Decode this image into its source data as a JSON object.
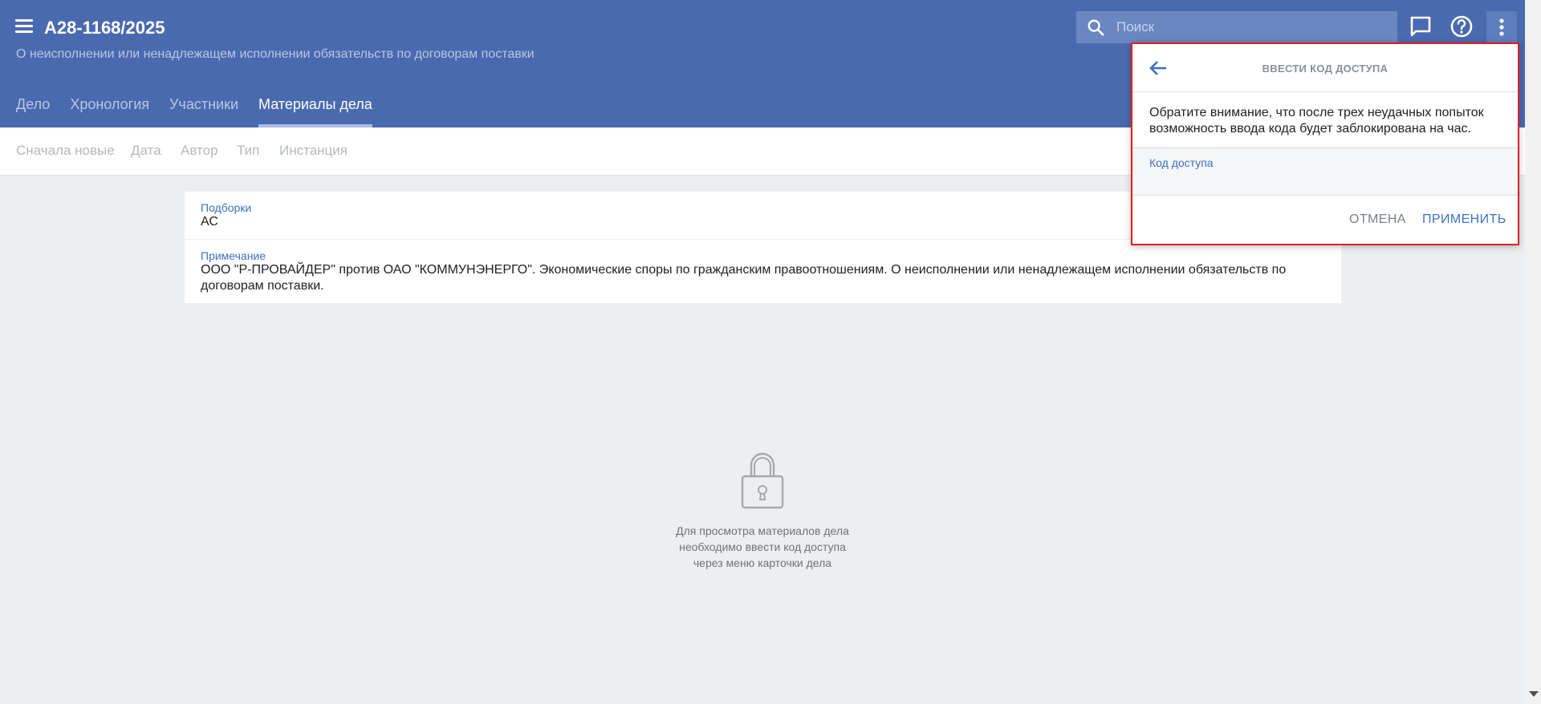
{
  "header": {
    "case_number": "А28-1168/2025",
    "subtitle": "О неисполнении или ненадлежащем исполнении обязательств по договорам поставки",
    "search_placeholder": "Поиск",
    "tabs": [
      {
        "label": "Дело",
        "active": false
      },
      {
        "label": "Хронология",
        "active": false
      },
      {
        "label": "Участники",
        "active": false
      },
      {
        "label": "Материалы дела",
        "active": true
      }
    ],
    "icons": [
      "menu-icon",
      "search-icon",
      "chat-icon",
      "help-icon",
      "more-vert-icon"
    ],
    "colors": {
      "bar": "#4a6aaf",
      "accent": "#3c70c4"
    }
  },
  "filters": [
    "Сначала новые",
    "Дата",
    "Автор",
    "Тип",
    "Инстанция"
  ],
  "info": {
    "collections_label": "Подборки",
    "collections_value": "АС",
    "note_label": "Примечание",
    "note_value": "ООО \"Р-ПРОВАЙДЕР\" против ОАО \"КОММУНЭНЕРГО\". Экономические споры по гражданским правоотношениям. О неисполнении или ненадлежащем исполнении обязательств по договорам поставки."
  },
  "locked": {
    "icon": "lock-icon",
    "line1": "Для просмотра материалов дела",
    "line2": "необходимо ввести код доступа",
    "line3": "через меню карточки дела"
  },
  "dialog": {
    "title": "ВВЕСТИ КОД ДОСТУПА",
    "note": "Обратите внимание, что после трех неудачных попыток возможность ввода кода будет заблокирована на час.",
    "field_label": "Код доступа",
    "field_value": "",
    "cancel_label": "ОТМЕНА",
    "apply_label": "ПРИМЕНИТЬ",
    "border_color": "#e0201f"
  }
}
